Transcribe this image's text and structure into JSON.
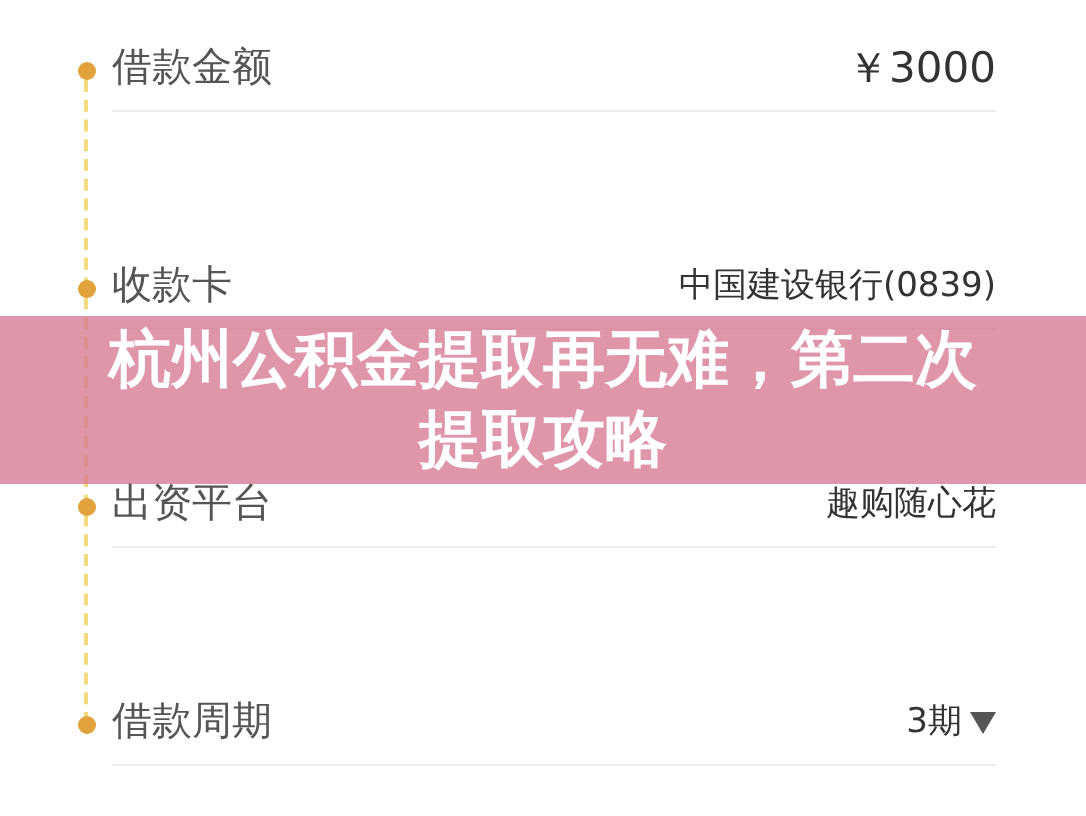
{
  "rows": [
    {
      "label": "借款金额",
      "value": "￥3000",
      "kind": "text"
    },
    {
      "label": "收款卡",
      "value": "中国建设银行(0839)",
      "kind": "text"
    },
    {
      "label": "出资平台",
      "value": "趣购随心花",
      "kind": "text"
    },
    {
      "label": "借款周期",
      "value": "3期",
      "kind": "dropdown"
    }
  ],
  "banner": {
    "title": "杭州公积金提取再无难，第二次提取攻略"
  }
}
